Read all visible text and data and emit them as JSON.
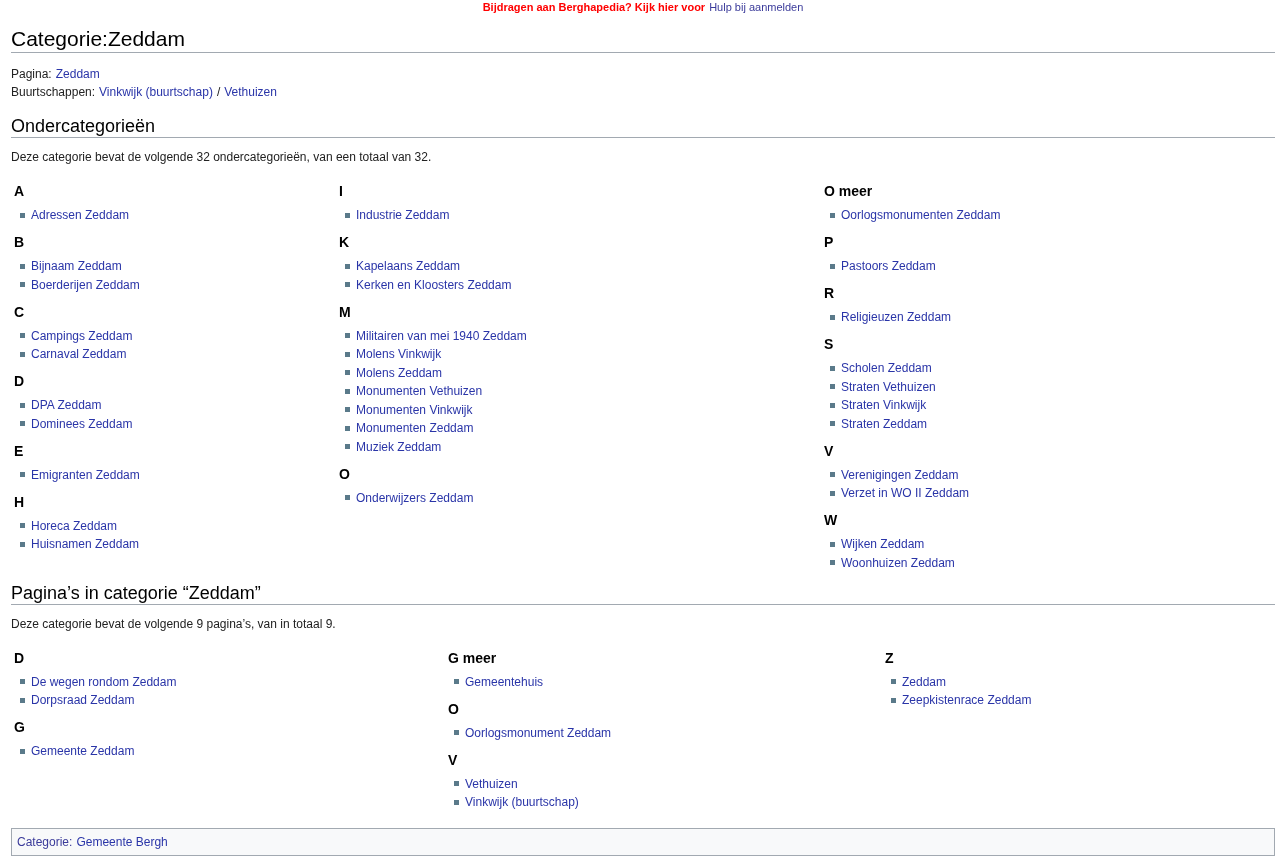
{
  "banner": {
    "text": "Bijdragen aan Berghapedia? Kijk hier voor",
    "link": "Hulp bij aanmelden"
  },
  "title": "Categorie:Zeddam",
  "info_lines": [
    {
      "label": "Pagina:",
      "links": [
        "Zeddam"
      ]
    },
    {
      "label": "Buurtschappen:",
      "links": [
        "Vinkwijk (buurtschap)",
        "Vethuizen"
      ],
      "separator": "/"
    }
  ],
  "sections": [
    {
      "heading": "Ondercategorieën",
      "description": "Deze categorie bevat de volgende 32 ondercategorieën, van een totaal van 32.",
      "columns": [
        [
          {
            "letter": "A",
            "items": [
              "Adressen Zeddam"
            ]
          },
          {
            "letter": "B",
            "items": [
              "Bijnaam Zeddam",
              "Boerderijen Zeddam"
            ]
          },
          {
            "letter": "C",
            "items": [
              "Campings Zeddam",
              "Carnaval Zeddam"
            ]
          },
          {
            "letter": "D",
            "items": [
              "DPA Zeddam",
              "Dominees Zeddam"
            ]
          },
          {
            "letter": "E",
            "items": [
              "Emigranten Zeddam"
            ]
          },
          {
            "letter": "H",
            "items": [
              "Horeca Zeddam",
              "Huisnamen Zeddam"
            ]
          }
        ],
        [
          {
            "letter": "I",
            "items": [
              "Industrie Zeddam"
            ]
          },
          {
            "letter": "K",
            "items": [
              "Kapelaans Zeddam",
              "Kerken en Kloosters Zeddam"
            ]
          },
          {
            "letter": "M",
            "items": [
              "Militairen van mei 1940 Zeddam",
              "Molens Vinkwijk",
              "Molens Zeddam",
              "Monumenten Vethuizen",
              "Monumenten Vinkwijk",
              "Monumenten Zeddam",
              "Muziek Zeddam"
            ]
          },
          {
            "letter": "O",
            "items": [
              "Onderwijzers Zeddam"
            ]
          }
        ],
        [
          {
            "letter": "O meer",
            "items": [
              "Oorlogsmonumenten Zeddam"
            ]
          },
          {
            "letter": "P",
            "items": [
              "Pastoors Zeddam"
            ]
          },
          {
            "letter": "R",
            "items": [
              "Religieuzen Zeddam"
            ]
          },
          {
            "letter": "S",
            "items": [
              "Scholen Zeddam",
              "Straten Vethuizen",
              "Straten Vinkwijk",
              "Straten Zeddam"
            ]
          },
          {
            "letter": "V",
            "items": [
              "Verenigingen Zeddam",
              "Verzet in WO II Zeddam"
            ]
          },
          {
            "letter": "W",
            "items": [
              "Wijken Zeddam",
              "Woonhuizen Zeddam"
            ]
          }
        ]
      ]
    },
    {
      "heading": "Pagina’s in categorie “Zeddam”",
      "description": "Deze categorie bevat de volgende 9 pagina’s, van in totaal 9.",
      "columns": [
        [
          {
            "letter": "D",
            "items": [
              "De wegen rondom Zeddam",
              "Dorpsraad Zeddam"
            ]
          },
          {
            "letter": "G",
            "items": [
              "Gemeente Zeddam"
            ]
          }
        ],
        [
          {
            "letter": "G meer",
            "items": [
              "Gemeentehuis"
            ]
          },
          {
            "letter": "O",
            "items": [
              "Oorlogsmonument Zeddam"
            ]
          },
          {
            "letter": "V",
            "items": [
              "Vethuizen",
              "Vinkwijk (buurtschap)"
            ]
          }
        ],
        [
          {
            "letter": "Z",
            "items": [
              "Zeddam",
              "Zeepkistenrace Zeddam"
            ]
          }
        ]
      ]
    }
  ],
  "footer": {
    "label": "Categorie:",
    "link": "Gemeente Bergh"
  }
}
